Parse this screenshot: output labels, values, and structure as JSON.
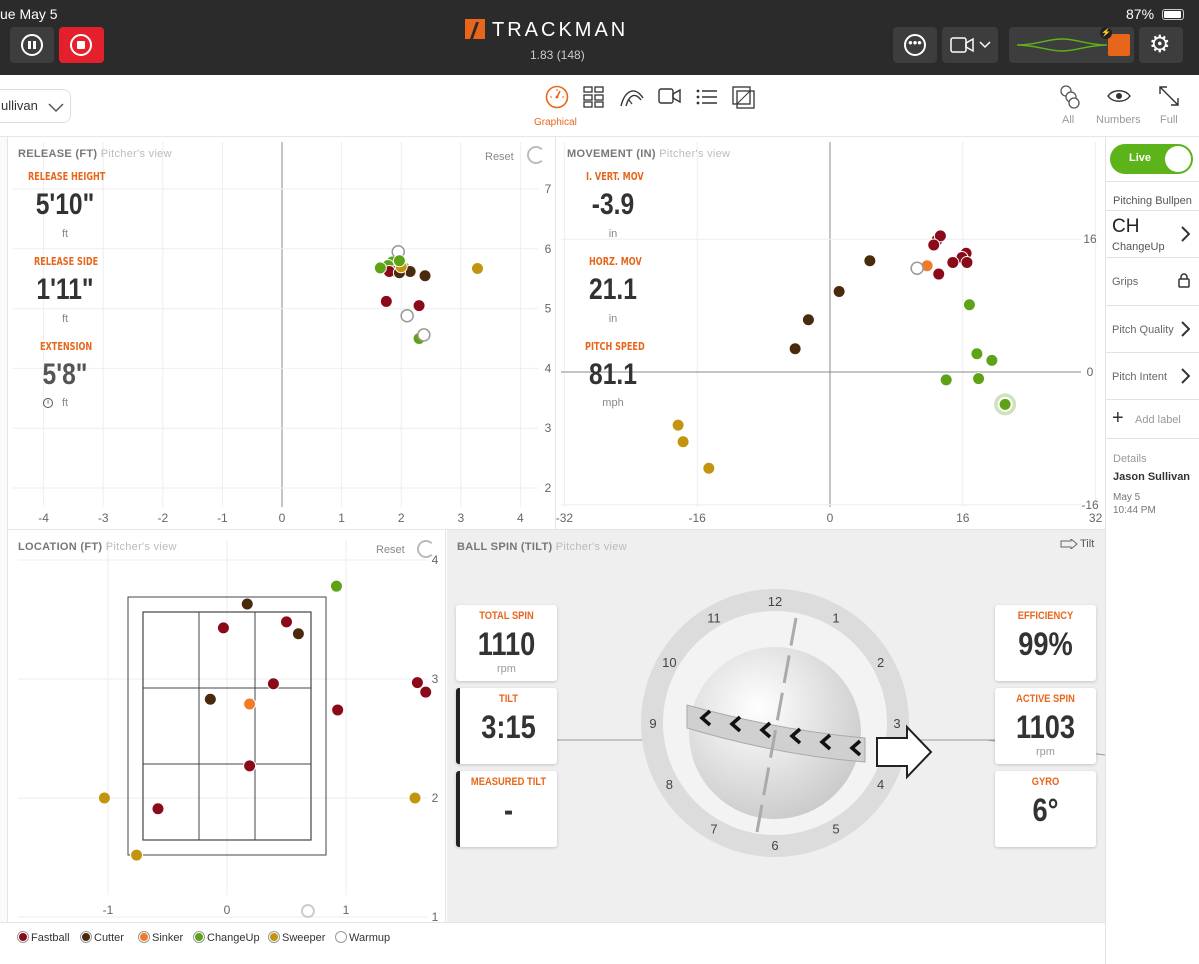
{
  "status_bar": {
    "date": "ue May 5",
    "battery": "87%"
  },
  "app": {
    "logo": "TRACKMAN",
    "version": "1.83 (148)"
  },
  "toolbar": {
    "player_select": "ullivan",
    "views": [
      {
        "icon": "gauge-icon",
        "label": "Graphical",
        "active": true
      },
      {
        "icon": "grid-icon",
        "label": ""
      },
      {
        "icon": "trajectory-icon",
        "label": ""
      },
      {
        "icon": "video-icon",
        "label": ""
      },
      {
        "icon": "list-icon",
        "label": ""
      },
      {
        "icon": "layers-icon",
        "label": ""
      }
    ],
    "right": [
      {
        "icon": "all-balls-icon",
        "label": "All"
      },
      {
        "icon": "eye-icon",
        "label": "Numbers"
      },
      {
        "icon": "expand-icon",
        "label": "Full"
      }
    ]
  },
  "release": {
    "title": "RELEASE (FT)",
    "subtitle": "Pitcher's view",
    "reset": "Reset",
    "height_label": "RELEASE HEIGHT",
    "height_value": "5'10\"",
    "height_unit": "ft",
    "side_label": "RELEASE SIDE",
    "side_value": "1'11\"",
    "side_unit": "ft",
    "ext_label": "EXTENSION",
    "ext_value": "5'8\"",
    "ext_unit": "ft",
    "x_ticks": [
      "-4",
      "-3",
      "-2",
      "-1",
      "0",
      "1",
      "2",
      "3",
      "4"
    ],
    "y_ticks": [
      "7",
      "6",
      "5",
      "4",
      "3",
      "2"
    ]
  },
  "movement": {
    "title": "MOVEMENT (IN)",
    "subtitle": "Pitcher's view",
    "ivb_label": "I. VERT. MOV",
    "ivb_value": "-3.9",
    "ivb_unit": "in",
    "hb_label": "HORZ. MOV",
    "hb_value": "21.1",
    "hb_unit": "in",
    "speed_label": "PITCH SPEED",
    "speed_value": "81.1",
    "speed_unit": "mph",
    "x_ticks": [
      "-32",
      "-16",
      "0",
      "16",
      "32"
    ],
    "y_ticks": [
      "16",
      "0",
      "-16"
    ]
  },
  "location": {
    "title": "LOCATION (FT)",
    "subtitle": "Pitcher's view",
    "reset": "Reset",
    "x_ticks": [
      "-1",
      "0",
      "1"
    ],
    "y_ticks": [
      "4",
      "3",
      "2",
      "1"
    ]
  },
  "spin": {
    "title": "BALL SPIN (TILT)",
    "subtitle": "Pitcher's view",
    "tilt_toggle": "Tilt",
    "total_label": "TOTAL SPIN",
    "total_value": "1110",
    "total_unit": "rpm",
    "tilt_label": "TILT",
    "tilt_value": "3:15",
    "mtilt_label": "MEASURED TILT",
    "mtilt_value": "-",
    "eff_label": "EFFICIENCY",
    "eff_value": "99%",
    "active_label": "ACTIVE SPIN",
    "active_value": "1103",
    "active_unit": "rpm",
    "gyro_label": "GYRO",
    "gyro_value": "6°",
    "clock": [
      "12",
      "1",
      "2",
      "3",
      "4",
      "5",
      "6",
      "7",
      "8",
      "9",
      "10",
      "11"
    ]
  },
  "sidebar": {
    "live": "Live",
    "session": "Pitching Bullpen",
    "pitch_code": "CH",
    "pitch_name": "ChangeUp",
    "grips": "Grips",
    "quality": "Pitch Quality",
    "intent": "Pitch Intent",
    "add_label": "Add label",
    "details": "Details",
    "player": "Jason Sullivan",
    "date": "May 5",
    "time": "10:44 PM"
  },
  "legend": [
    {
      "name": "Fastball",
      "color": "#8b0a1a"
    },
    {
      "name": "Cutter",
      "color": "#4a2a0c"
    },
    {
      "name": "Sinker",
      "color": "#f07c2a"
    },
    {
      "name": "ChangeUp",
      "color": "#5ea316"
    },
    {
      "name": "Sweeper",
      "color": "#c1960e"
    },
    {
      "name": "Warmup",
      "color": "#ffffff"
    }
  ],
  "colors": {
    "accent": "#e8661c",
    "live": "#5cb31a",
    "record": "#e3202c"
  }
}
